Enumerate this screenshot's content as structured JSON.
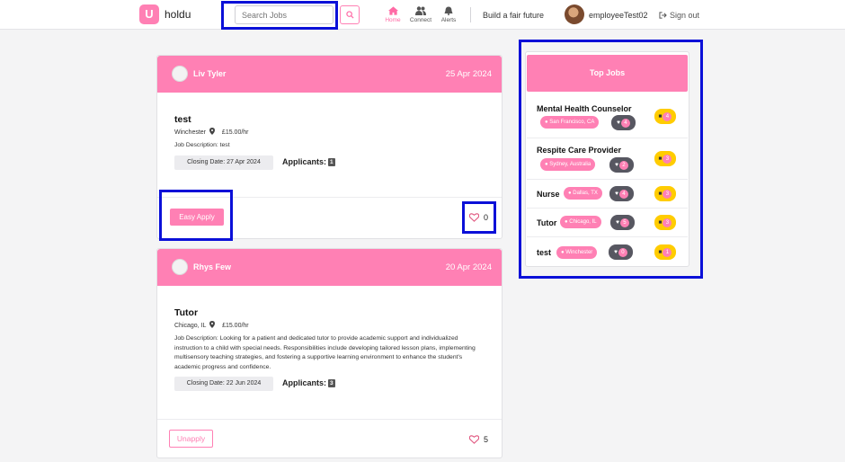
{
  "brand": {
    "logo_letter": "U",
    "name": "holdu"
  },
  "search": {
    "placeholder": "Search Jobs"
  },
  "nav": {
    "home": "Home",
    "connect": "Connect",
    "alerts": "Alerts"
  },
  "header": {
    "tagline": "Build a fair future",
    "username": "employeeTest02",
    "signout": "Sign out"
  },
  "colors": {
    "accent": "#ff80b4",
    "highlight": "#0b10d8",
    "badge_yellow": "#ffcc00",
    "badge_dark": "#575761"
  },
  "jobs": [
    {
      "poster": "Liv Tyler",
      "date": "25 Apr 2024",
      "title": "test",
      "location": "Winchester",
      "rate": "£15.00/hr",
      "description": "Job Description: test",
      "closing": "Closing Date: 27 Apr 2024",
      "applicants_label": "Applicants:",
      "applicants": "1",
      "action": "Easy Apply",
      "likes": "0"
    },
    {
      "poster": "Rhys Few",
      "date": "20 Apr 2024",
      "title": "Tutor",
      "location": "Chicago, IL",
      "rate": "£15.00/hr",
      "description": "Job Description: Looking for a patient and dedicated tutor to provide academic support and individualized instruction to a child with special needs. Responsibilities include developing tailored lesson plans, implementing multisensory teaching strategies, and fostering a supportive learning environment to enhance the student's academic progress and confidence.",
      "closing": "Closing Date: 22 Jun 2024",
      "applicants_label": "Applicants:",
      "applicants": "3",
      "action": "Unapply",
      "likes": "5"
    }
  ],
  "top_jobs": {
    "title": "Top Jobs",
    "items": [
      {
        "title": "Mental Health Counselor",
        "location": "San Francisco, CA",
        "likes": "4",
        "applicants": "4"
      },
      {
        "title": "Respite Care Provider",
        "location": "Sydney, Australia",
        "likes": "2",
        "applicants": "3"
      },
      {
        "title": "Nurse",
        "location": "Dallas, TX",
        "likes": "4",
        "applicants": "3"
      },
      {
        "title": "Tutor",
        "location": "Chicago, IL",
        "likes": "5",
        "applicants": "3"
      },
      {
        "title": "test",
        "location": "Winchester",
        "likes": "0",
        "applicants": "1"
      }
    ]
  }
}
